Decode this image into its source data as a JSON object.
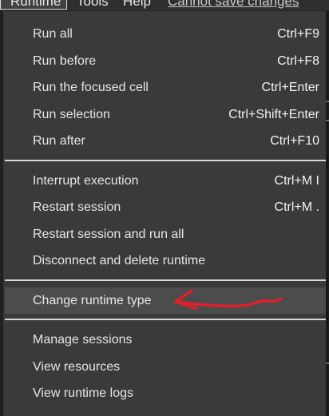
{
  "menubar": {
    "runtime": "Runtime",
    "tools": "Tools",
    "help": "Help",
    "save_warning": "Cannot save changes"
  },
  "runtime_menu": {
    "group1": [
      {
        "label": "Run all",
        "shortcut": "Ctrl+F9"
      },
      {
        "label": "Run before",
        "shortcut": "Ctrl+F8"
      },
      {
        "label": "Run the focused cell",
        "shortcut": "Ctrl+Enter"
      },
      {
        "label": "Run selection",
        "shortcut": "Ctrl+Shift+Enter"
      },
      {
        "label": "Run after",
        "shortcut": "Ctrl+F10"
      }
    ],
    "group2": [
      {
        "label": "Interrupt execution",
        "shortcut": "Ctrl+M I"
      },
      {
        "label": "Restart session",
        "shortcut": "Ctrl+M ."
      },
      {
        "label": "Restart session and run all",
        "shortcut": ""
      },
      {
        "label": "Disconnect and delete runtime",
        "shortcut": ""
      }
    ],
    "group3": [
      {
        "label": "Change runtime type",
        "shortcut": ""
      }
    ],
    "group4": [
      {
        "label": "Manage sessions",
        "shortcut": ""
      },
      {
        "label": "View resources",
        "shortcut": ""
      },
      {
        "label": "View runtime logs",
        "shortcut": ""
      }
    ]
  },
  "colors": {
    "menu_bg": "#3a3a3a",
    "highlight_bg": "#4c4c4c",
    "annotation": "#e0202a"
  }
}
